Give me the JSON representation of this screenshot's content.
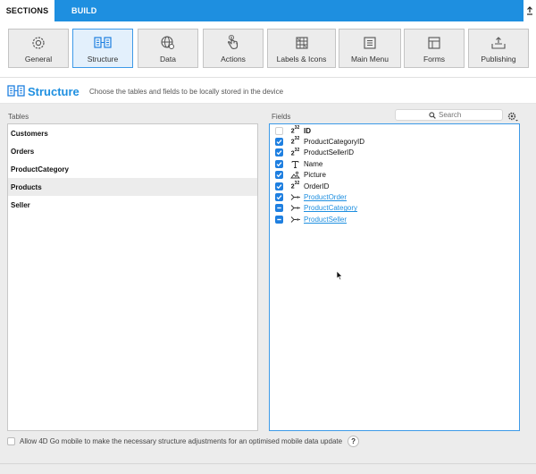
{
  "topbar": {
    "tabs": [
      {
        "label": "SECTIONS",
        "active": true
      },
      {
        "label": "BUILD",
        "active": false
      }
    ],
    "accent": "#1e8fe0"
  },
  "sections": [
    {
      "label": "General",
      "icon": "gear-icon",
      "active": false
    },
    {
      "label": "Structure",
      "icon": "structure-icon",
      "active": true
    },
    {
      "label": "Data",
      "icon": "globe-icon",
      "active": false
    },
    {
      "label": "Actions",
      "icon": "pointer-hand-icon",
      "active": false
    },
    {
      "label": "Labels & Icons",
      "icon": "labels-grid-icon",
      "active": false
    },
    {
      "label": "Main Menu",
      "icon": "menu-list-icon",
      "active": false
    },
    {
      "label": "Forms",
      "icon": "forms-layout-icon",
      "active": false
    },
    {
      "label": "Publishing",
      "icon": "publish-tray-icon",
      "active": false
    }
  ],
  "header": {
    "title": "Structure",
    "description": "Choose the tables and fields to be locally stored in the device"
  },
  "tables_panel": {
    "label": "Tables",
    "items": [
      {
        "name": "Customers",
        "selected": false
      },
      {
        "name": "Orders",
        "selected": false
      },
      {
        "name": "ProductCategory",
        "selected": false
      },
      {
        "name": "Products",
        "selected": true
      },
      {
        "name": "Seller",
        "selected": false
      }
    ]
  },
  "fields_panel": {
    "label": "Fields",
    "search_placeholder": "Search",
    "items": [
      {
        "name": "ID",
        "type": "number-icon",
        "state": "unchecked",
        "style": "bold"
      },
      {
        "name": "ProductCategoryID",
        "type": "number-icon",
        "state": "checked",
        "style": "normal"
      },
      {
        "name": "ProductSellerID",
        "type": "number-icon",
        "state": "checked",
        "style": "normal"
      },
      {
        "name": "Name",
        "type": "text-icon",
        "state": "checked",
        "style": "normal"
      },
      {
        "name": "Picture",
        "type": "picture-icon",
        "state": "checked",
        "style": "normal"
      },
      {
        "name": "OrderID",
        "type": "number-icon",
        "state": "checked",
        "style": "normal"
      },
      {
        "name": "ProductOrder",
        "type": "relation-icon",
        "state": "checked",
        "style": "link"
      },
      {
        "name": "ProductCategory",
        "type": "relation-icon",
        "state": "mixed",
        "style": "link"
      },
      {
        "name": "ProductSeller",
        "type": "relation-icon",
        "state": "mixed",
        "style": "link"
      }
    ]
  },
  "footer": {
    "option_label": "Allow 4D Go mobile to make the necessary structure adjustments for an optimised mobile data update",
    "help_label": "?"
  }
}
